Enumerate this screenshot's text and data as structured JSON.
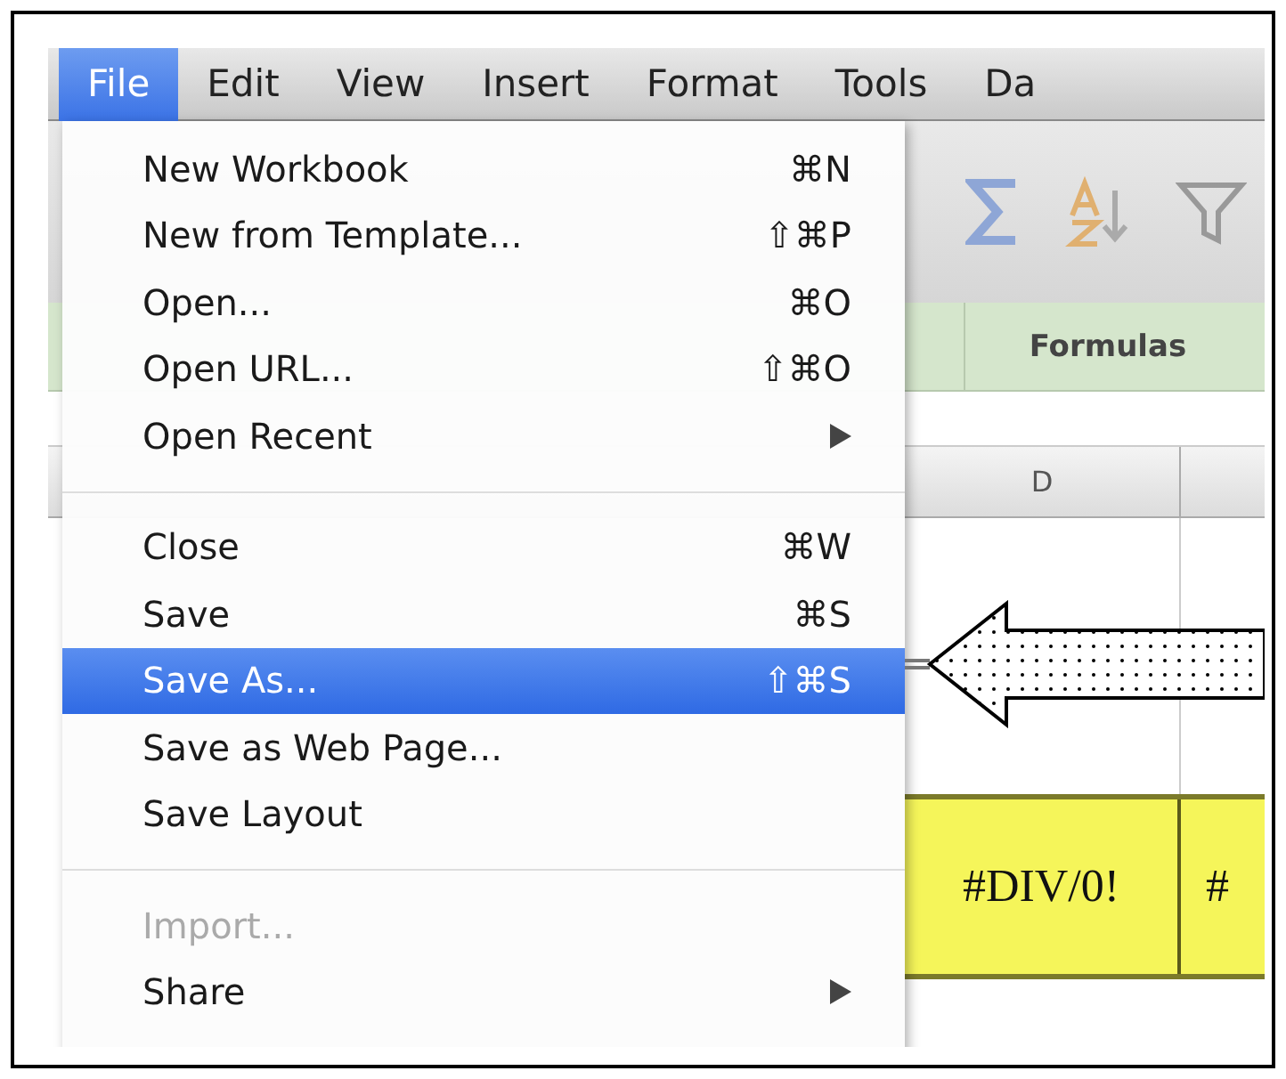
{
  "menu_bar": [
    {
      "label": "File",
      "selected": true
    },
    {
      "label": "Edit",
      "selected": false
    },
    {
      "label": "View",
      "selected": false
    },
    {
      "label": "Insert",
      "selected": false
    },
    {
      "label": "Format",
      "selected": false
    },
    {
      "label": "Tools",
      "selected": false
    },
    {
      "label": "Da",
      "selected": false
    }
  ],
  "file_menu": [
    {
      "kind": "item",
      "label": "New Workbook",
      "shortcut": "⌘N",
      "selected": false,
      "disabled": false
    },
    {
      "kind": "item",
      "label": "New from Template...",
      "shortcut": "⇧⌘P",
      "selected": false,
      "disabled": false
    },
    {
      "kind": "item",
      "label": "Open...",
      "shortcut": "⌘O",
      "selected": false,
      "disabled": false
    },
    {
      "kind": "item",
      "label": "Open URL...",
      "shortcut": "⇧⌘O",
      "selected": false,
      "disabled": false
    },
    {
      "kind": "item",
      "label": "Open Recent",
      "submenu": true,
      "selected": false,
      "disabled": false
    },
    {
      "kind": "separator"
    },
    {
      "kind": "item",
      "label": "Close",
      "shortcut": "⌘W",
      "selected": false,
      "disabled": false
    },
    {
      "kind": "item",
      "label": "Save",
      "shortcut": "⌘S",
      "selected": false,
      "disabled": false
    },
    {
      "kind": "item",
      "label": "Save As...",
      "shortcut": "⇧⌘S",
      "selected": true,
      "disabled": false
    },
    {
      "kind": "item",
      "label": "Save as Web Page...",
      "selected": false,
      "disabled": false
    },
    {
      "kind": "item",
      "label": "Save Layout",
      "selected": false,
      "disabled": false
    },
    {
      "kind": "separator"
    },
    {
      "kind": "item",
      "label": "Import...",
      "selected": false,
      "disabled": true
    },
    {
      "kind": "item",
      "label": "Share",
      "submenu": true,
      "selected": false,
      "disabled": false
    }
  ],
  "ribbon_tab": {
    "label": "Formulas"
  },
  "column_header": {
    "label": "D"
  },
  "cells": [
    {
      "value": "#DIV/0!"
    },
    {
      "value": "#"
    }
  ]
}
